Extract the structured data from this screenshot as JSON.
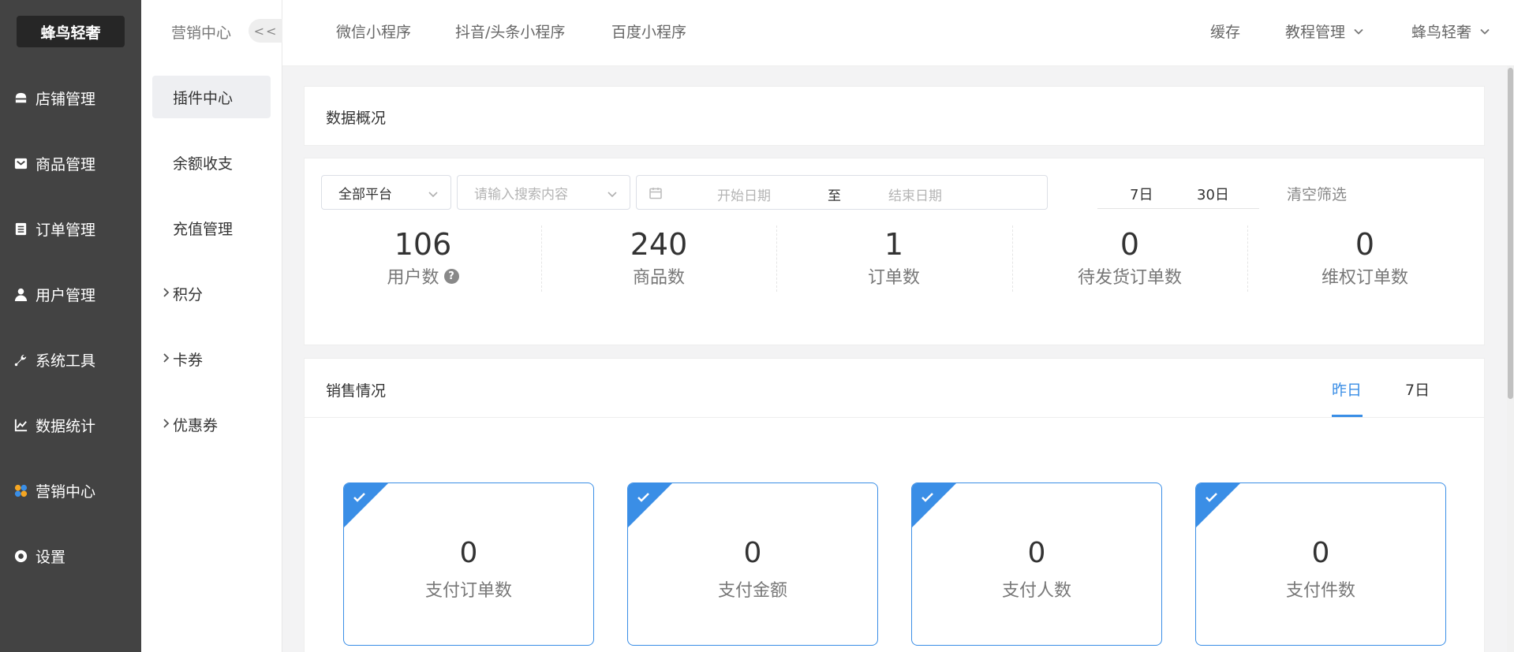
{
  "brand": "蜂鸟轻奢",
  "sidebar": {
    "items": [
      {
        "label": "店铺管理",
        "icon": "shop-icon"
      },
      {
        "label": "商品管理",
        "icon": "goods-icon"
      },
      {
        "label": "订单管理",
        "icon": "order-icon"
      },
      {
        "label": "用户管理",
        "icon": "user-icon"
      },
      {
        "label": "系统工具",
        "icon": "wrench-icon"
      },
      {
        "label": "数据统计",
        "icon": "chart-icon"
      },
      {
        "label": "营销中心",
        "icon": "marketing-icon"
      },
      {
        "label": "设置",
        "icon": "settings-icon"
      }
    ]
  },
  "subbar": {
    "title": "营销中心",
    "collapse_label": "<<",
    "items": [
      {
        "label": "插件中心",
        "active": true
      },
      {
        "label": "余额收支"
      },
      {
        "label": "充值管理"
      },
      {
        "label": "积分",
        "expandable": true
      },
      {
        "label": "卡券",
        "expandable": true
      },
      {
        "label": "优惠券",
        "expandable": true
      }
    ]
  },
  "topbar": {
    "tabs": [
      "微信小程序",
      "抖音/头条小程序",
      "百度小程序"
    ],
    "cache": "缓存",
    "tutorial": "教程管理",
    "user": "蜂鸟轻奢"
  },
  "overview": {
    "title": "数据概况",
    "platform_select": "全部平台",
    "search_placeholder": "请输入搜索内容",
    "start_date": "开始日期",
    "range_sep": "至",
    "end_date": "结束日期",
    "quick_7": "7日",
    "quick_30": "30日",
    "clear": "清空筛选",
    "stats": [
      {
        "value": "106",
        "label": "用户数"
      },
      {
        "value": "240",
        "label": "商品数"
      },
      {
        "value": "1",
        "label": "订单数"
      },
      {
        "value": "0",
        "label": "待发货订单数"
      },
      {
        "value": "0",
        "label": "维权订单数"
      }
    ]
  },
  "sales": {
    "title": "销售情况",
    "tab_yesterday": "昨日",
    "tab_7": "7日",
    "metrics": [
      {
        "value": "0",
        "label": "支付订单数"
      },
      {
        "value": "0",
        "label": "支付金额"
      },
      {
        "value": "0",
        "label": "支付人数"
      },
      {
        "value": "0",
        "label": "支付件数"
      }
    ]
  },
  "colors": {
    "accent": "#3a8ee6",
    "sidebar": "#434343"
  }
}
